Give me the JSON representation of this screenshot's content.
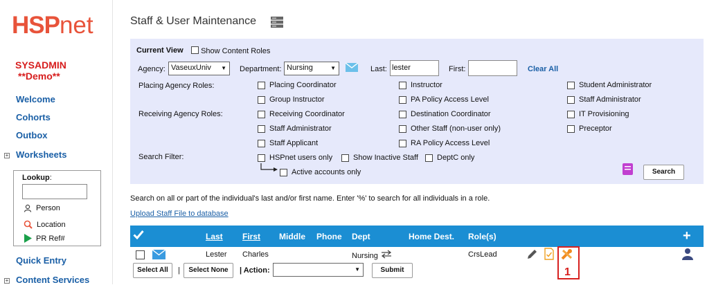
{
  "sidebar": {
    "logo_hsp": "HSP",
    "logo_net": "net",
    "user_line1": "SYSADMIN",
    "user_line2": "**Demo**",
    "links": {
      "welcome": "Welcome",
      "cohorts": "Cohorts",
      "outbox": "Outbox",
      "worksheets": "Worksheets",
      "quick_entry": "Quick Entry",
      "content_services": "Content Services"
    },
    "lookup": {
      "label": "Lookup",
      "label_colon": ":",
      "value": "",
      "person": "Person",
      "location": "Location",
      "pr_ref": "PR Ref#"
    }
  },
  "page": {
    "title": "Staff & User Maintenance"
  },
  "filters": {
    "current_view": "Current View",
    "show_content_roles": "Show Content Roles",
    "agency_label": "Agency:",
    "agency_value": "VaseuxUniv",
    "department_label": "Department:",
    "department_value": "Nursing",
    "last_label": "Last:",
    "last_value": "lester",
    "first_label": "First:",
    "first_value": "",
    "clear_all": "Clear All",
    "placing_roles_label": "Placing Agency Roles:",
    "receiving_roles_label": "Receiving Agency Roles:",
    "search_filter_label": "Search Filter:",
    "roles_col1": [
      "Placing Coordinator",
      "Group Instructor",
      "Receiving Coordinator",
      "Staff Administrator",
      "Staff Applicant"
    ],
    "roles_col2": [
      "Instructor",
      "PA Policy Access Level",
      "Destination Coordinator",
      "Other Staff (non-user only)",
      "RA Policy Access Level"
    ],
    "roles_col3": [
      "Student Administrator",
      "Staff Administrator",
      "IT Provisioning",
      "Preceptor"
    ],
    "hspnet_users_only": "HSPnet users only",
    "show_inactive_staff": "Show Inactive Staff",
    "deptc_only": "DeptC only",
    "active_accounts_only": "Active accounts only",
    "search_button": "Search"
  },
  "help_text": "Search on all or part of the individual's last and/or first name. Enter '%' to search for all individuals in a role.",
  "upload_link": "Upload Staff File to database",
  "table": {
    "headers": {
      "last": "Last",
      "first": "First",
      "middle": "Middle",
      "phone": "Phone",
      "dept": "Dept",
      "home_dest": "Home Dest.",
      "roles": "Role(s)"
    },
    "row": {
      "last": "Lester",
      "first": "Charles",
      "dept": "Nursing",
      "roles": "CrsLead"
    }
  },
  "actions": {
    "select_all": "Select All",
    "sep1": "|",
    "select_none": "Select None",
    "action_label": "| Action:",
    "action_value": "",
    "submit": "Submit"
  },
  "annotation": {
    "marker": "1"
  },
  "colors": {
    "header_blue": "#1b8ed3",
    "panel_bg": "#e6e9fb",
    "logo_red": "#e8533a",
    "link_blue": "#1a5fa6",
    "marker_red": "#d7201e"
  }
}
